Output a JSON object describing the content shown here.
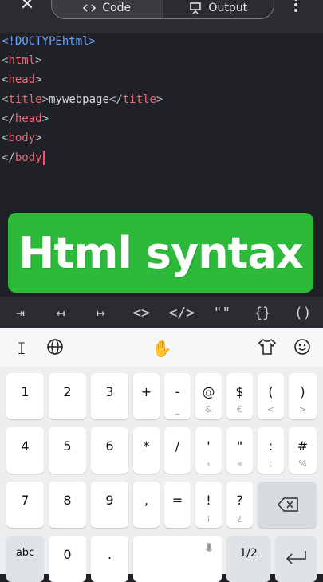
{
  "topbar": {
    "close_icon": "close-icon",
    "tabs": [
      {
        "label": "Code",
        "icon": "code-icon",
        "active": true
      },
      {
        "label": "Output",
        "icon": "presentation-icon",
        "active": false
      }
    ],
    "menu_icon": "more-vert-icon"
  },
  "editor": {
    "lines": [
      {
        "l": "<!DOCTYPEhtml>"
      },
      {
        "open": "<",
        "tag": "html",
        "close": ">"
      },
      {
        "open": "<",
        "tag": "head",
        "close": ">"
      },
      {
        "open": "<",
        "tag": "title",
        "close": ">",
        "text": "mywebpage",
        "open2": "</",
        "tag2": "title",
        "close2": ">"
      },
      {
        "open": "</",
        "tag": "head",
        "close": ">"
      },
      {
        "open": "<",
        "tag": "body",
        "close": ">"
      },
      {
        "open": "</",
        "tag": "body",
        "close": ""
      }
    ]
  },
  "banner": {
    "text": "Html syntax"
  },
  "symbols": [
    "⇥",
    "↤",
    "↦",
    "<>",
    "</>",
    "\"\"",
    "{}",
    "()"
  ],
  "keyboard": {
    "toolbar": {
      "cursor_icon": "text-cursor-icon",
      "globe_icon": "globe-icon",
      "hand_icon": "gesture-icon",
      "shirt_icon": "theme-icon",
      "emoji_icon": "emoji-icon"
    },
    "rows": [
      [
        {
          "m": "1",
          "s": ""
        },
        {
          "m": "2",
          "s": ""
        },
        {
          "m": "3",
          "s": ""
        },
        {
          "m": "+",
          "s": ""
        },
        {
          "m": "-",
          "s": "_"
        },
        {
          "m": "@",
          "s": "&"
        },
        {
          "m": "$",
          "s": "€"
        },
        {
          "m": "(",
          "s": "<"
        },
        {
          "m": ")",
          "s": ">"
        }
      ],
      [
        {
          "m": "4",
          "s": ""
        },
        {
          "m": "5",
          "s": ""
        },
        {
          "m": "6",
          "s": ""
        },
        {
          "m": "*",
          "s": ""
        },
        {
          "m": "/",
          "s": ""
        },
        {
          "m": "'",
          "s": "‹"
        },
        {
          "m": "\"",
          "s": "«"
        },
        {
          "m": ":",
          "s": ";"
        },
        {
          "m": "#",
          "s": "%"
        }
      ],
      [
        {
          "m": "7",
          "s": ""
        },
        {
          "m": "8",
          "s": ""
        },
        {
          "m": "9",
          "s": ""
        },
        {
          "m": ",",
          "s": ""
        },
        {
          "m": "=",
          "s": ""
        },
        {
          "m": "!",
          "s": "¡"
        },
        {
          "m": "?",
          "s": "¿"
        }
      ],
      [
        {
          "m": "abc",
          "s": ""
        },
        {
          "m": "0",
          "s": ""
        },
        {
          "m": ".",
          "s": ""
        },
        {
          "m": "1/2",
          "s": ""
        }
      ]
    ],
    "backspace_icon": "backspace-icon",
    "enter_icon": "enter-icon",
    "mic_icon": "mic-icon"
  }
}
